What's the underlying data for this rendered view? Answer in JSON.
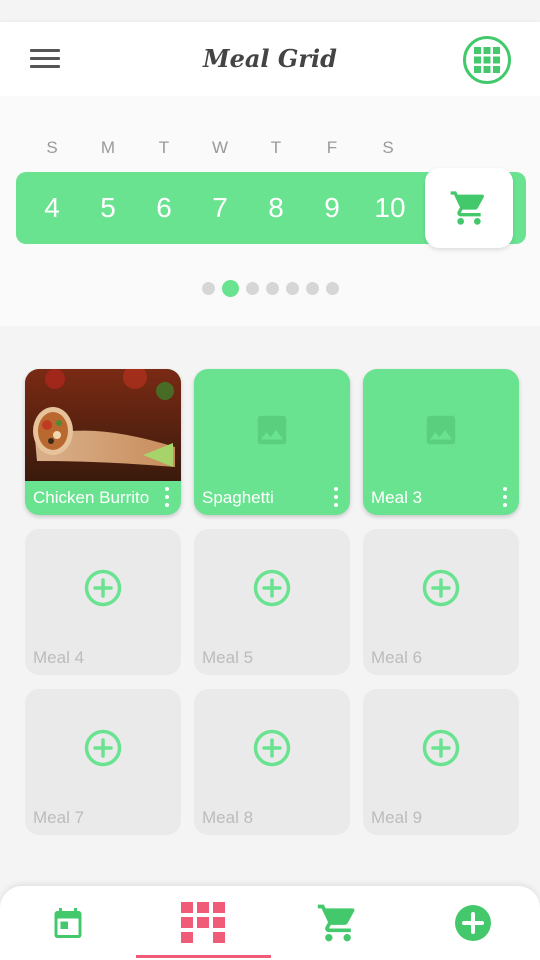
{
  "app": {
    "title": "Meal Grid"
  },
  "colors": {
    "accent": "#6ae391",
    "accent_dark": "#43c86b",
    "active_nav": "#f05b78",
    "empty_tile": "#eaeaea"
  },
  "icons": {
    "menu": "hamburger-menu-icon",
    "grid_toggle": "grid-icon",
    "cart": "shopping-cart-icon",
    "image_placeholder": "image-icon",
    "add": "add-circle-icon",
    "more": "more-vert-icon",
    "calendar": "calendar-icon"
  },
  "week": {
    "day_letters": [
      "S",
      "M",
      "T",
      "W",
      "T",
      "F",
      "S"
    ],
    "dates": [
      "4",
      "5",
      "6",
      "7",
      "8",
      "9",
      "10"
    ],
    "page_count": 7,
    "active_page": 2
  },
  "meals": [
    {
      "label": "Chicken Burrito",
      "state": "photo"
    },
    {
      "label": "Spaghetti",
      "state": "placeholder"
    },
    {
      "label": "Meal 3",
      "state": "placeholder"
    },
    {
      "label": "Meal 4",
      "state": "empty"
    },
    {
      "label": "Meal 5",
      "state": "empty"
    },
    {
      "label": "Meal 6",
      "state": "empty"
    },
    {
      "label": "Meal 7",
      "state": "empty"
    },
    {
      "label": "Meal 8",
      "state": "empty"
    },
    {
      "label": "Meal 9",
      "state": "empty"
    }
  ],
  "bottom_nav": {
    "active_index": 1,
    "items": [
      "calendar",
      "meal-grid",
      "shopping-cart",
      "add"
    ]
  }
}
